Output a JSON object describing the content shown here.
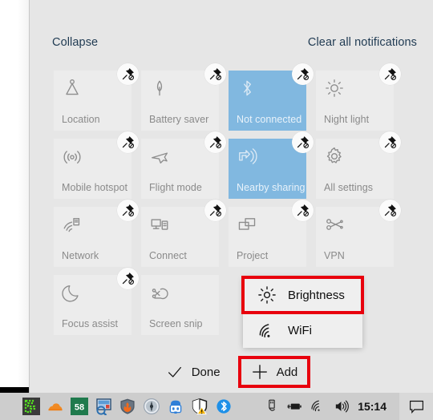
{
  "colors": {
    "panel_bg": "#e6e6e6",
    "tile_off": "#ececec",
    "tile_on": "#81b8e0",
    "link_text": "#1f3a52",
    "highlight_red": "#e8000d",
    "taskbar": "#cdcdcd"
  },
  "action_center": {
    "collapse_label": "Collapse",
    "clear_label": "Clear all notifications",
    "tiles": [
      [
        {
          "label": "Location",
          "icon": "location-icon",
          "state": "off",
          "pinned": true
        },
        {
          "label": "Battery saver",
          "icon": "battery-saver-icon",
          "state": "off",
          "pinned": true
        },
        {
          "label": "Not connected",
          "icon": "bluetooth-icon",
          "state": "on",
          "pinned": true
        },
        {
          "label": "Night light",
          "icon": "night-light-icon",
          "state": "off",
          "pinned": true
        }
      ],
      [
        {
          "label": "Mobile hotspot",
          "icon": "mobile-hotspot-icon",
          "state": "off",
          "pinned": true
        },
        {
          "label": "Flight mode",
          "icon": "airplane-icon",
          "state": "off",
          "pinned": true
        },
        {
          "label": "Nearby sharing",
          "icon": "nearby-sharing-icon",
          "state": "on",
          "pinned": true
        },
        {
          "label": "All settings",
          "icon": "gear-icon",
          "state": "off",
          "pinned": true
        }
      ],
      [
        {
          "label": "Network",
          "icon": "network-icon",
          "state": "off",
          "pinned": true
        },
        {
          "label": "Connect",
          "icon": "connect-icon",
          "state": "off",
          "pinned": true
        },
        {
          "label": "Project",
          "icon": "project-icon",
          "state": "off",
          "pinned": true
        },
        {
          "label": "VPN",
          "icon": "vpn-icon",
          "state": "off",
          "pinned": true
        }
      ],
      [
        {
          "label": "Focus assist",
          "icon": "moon-icon",
          "state": "off",
          "pinned": true
        },
        {
          "label": "Screen snip",
          "icon": "screen-snip-icon",
          "state": "off",
          "pinned": false
        }
      ]
    ],
    "pin_badge_icon": "unpin-icon",
    "popup": {
      "items": [
        {
          "label": "Brightness",
          "icon": "brightness-icon",
          "highlighted": true
        },
        {
          "label": "WiFi",
          "icon": "wifi-icon",
          "highlighted": false
        }
      ]
    },
    "footer": {
      "done_label": "Done",
      "done_icon": "checkmark-icon",
      "add_label": "Add",
      "add_icon": "plus-icon",
      "add_highlighted": true
    }
  },
  "taskbar": {
    "app_icons": [
      {
        "name": "snake-game-icon"
      },
      {
        "name": "cloud-icon"
      },
      {
        "name": "counter-badge-icon",
        "badge": "58"
      },
      {
        "name": "screenshot-tool-icon"
      },
      {
        "name": "firewall-icon"
      },
      {
        "name": "signal-tower-icon"
      },
      {
        "name": "robot-icon"
      },
      {
        "name": "shield-warning-icon"
      },
      {
        "name": "bluetooth-tray-icon"
      }
    ],
    "counter_badge_text": "58",
    "system_icons": [
      {
        "name": "usb-eject-icon"
      },
      {
        "name": "battery-charging-icon"
      },
      {
        "name": "wifi-tray-icon"
      },
      {
        "name": "volume-icon"
      }
    ],
    "clock": "15:14",
    "notification_icon": "notification-chat-icon"
  }
}
